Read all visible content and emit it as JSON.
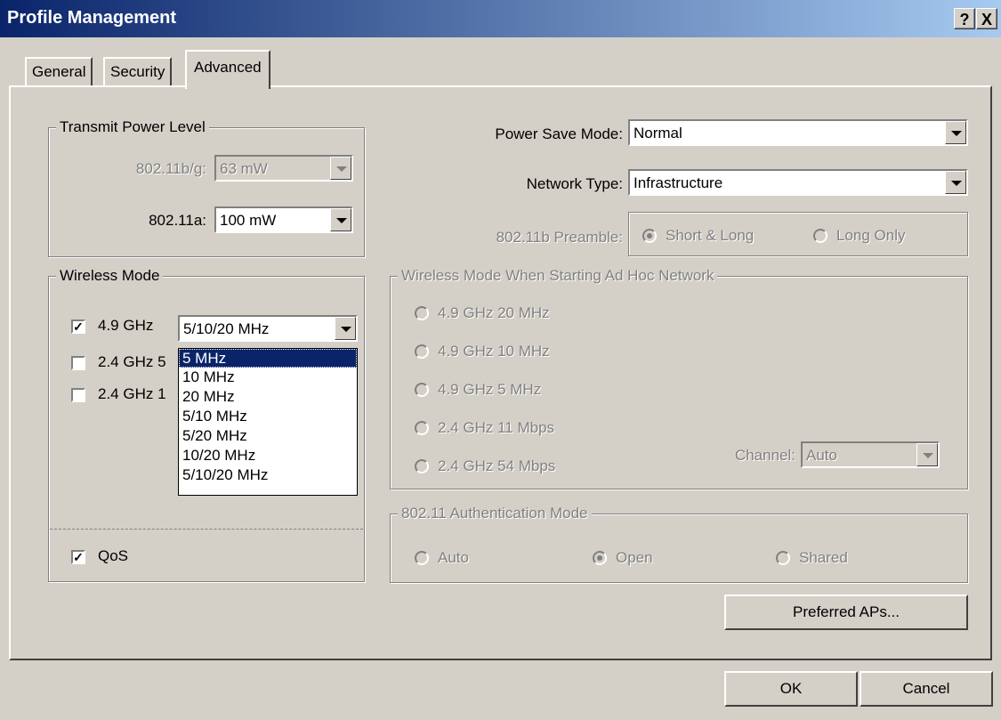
{
  "window": {
    "title": "Profile Management",
    "help_button": "?",
    "close_button": "X"
  },
  "tabs": [
    {
      "label": "General"
    },
    {
      "label": "Security"
    },
    {
      "label": "Advanced"
    }
  ],
  "transmit_power": {
    "legend": "Transmit Power Level",
    "bg_label": "802.11b/g:",
    "bg_value": "63 mW",
    "a_label": "802.11a:",
    "a_value": "100 mW"
  },
  "power_save": {
    "label": "Power Save Mode:",
    "value": "Normal"
  },
  "network_type": {
    "label": "Network Type:",
    "value": "Infrastructure"
  },
  "preamble": {
    "label": "802.11b Preamble:",
    "options": [
      "Short & Long",
      "Long Only"
    ],
    "selected": "Short & Long"
  },
  "wireless_mode": {
    "legend": "Wireless Mode",
    "items": [
      {
        "label": "4.9 GHz",
        "checked": true
      },
      {
        "label": "2.4 GHz 5",
        "checked": false
      },
      {
        "label": "2.4 GHz 1",
        "checked": false
      }
    ],
    "bandwidth_value": "5/10/20 MHz",
    "dropdown_options": [
      "5 MHz",
      "10 MHz",
      "20 MHz",
      "5/10 MHz",
      "5/20 MHz",
      "10/20 MHz",
      "5/10/20 MHz"
    ],
    "highlighted": "5 MHz",
    "qos_label": "QoS",
    "qos_checked": true
  },
  "adhoc": {
    "legend": "Wireless Mode When Starting Ad Hoc Network",
    "options": [
      "4.9 GHz 20 MHz",
      "4.9 GHz 10 MHz",
      "4.9 GHz 5 MHz",
      "2.4 GHz 11 Mbps",
      "2.4 GHz 54 Mbps"
    ],
    "channel_label": "Channel:",
    "channel_value": "Auto"
  },
  "auth": {
    "legend": "802.11 Authentication Mode",
    "options": [
      "Auto",
      "Open",
      "Shared"
    ],
    "selected": "Open"
  },
  "buttons": {
    "preferred_aps": "Preferred APs...",
    "ok": "OK",
    "cancel": "Cancel"
  }
}
